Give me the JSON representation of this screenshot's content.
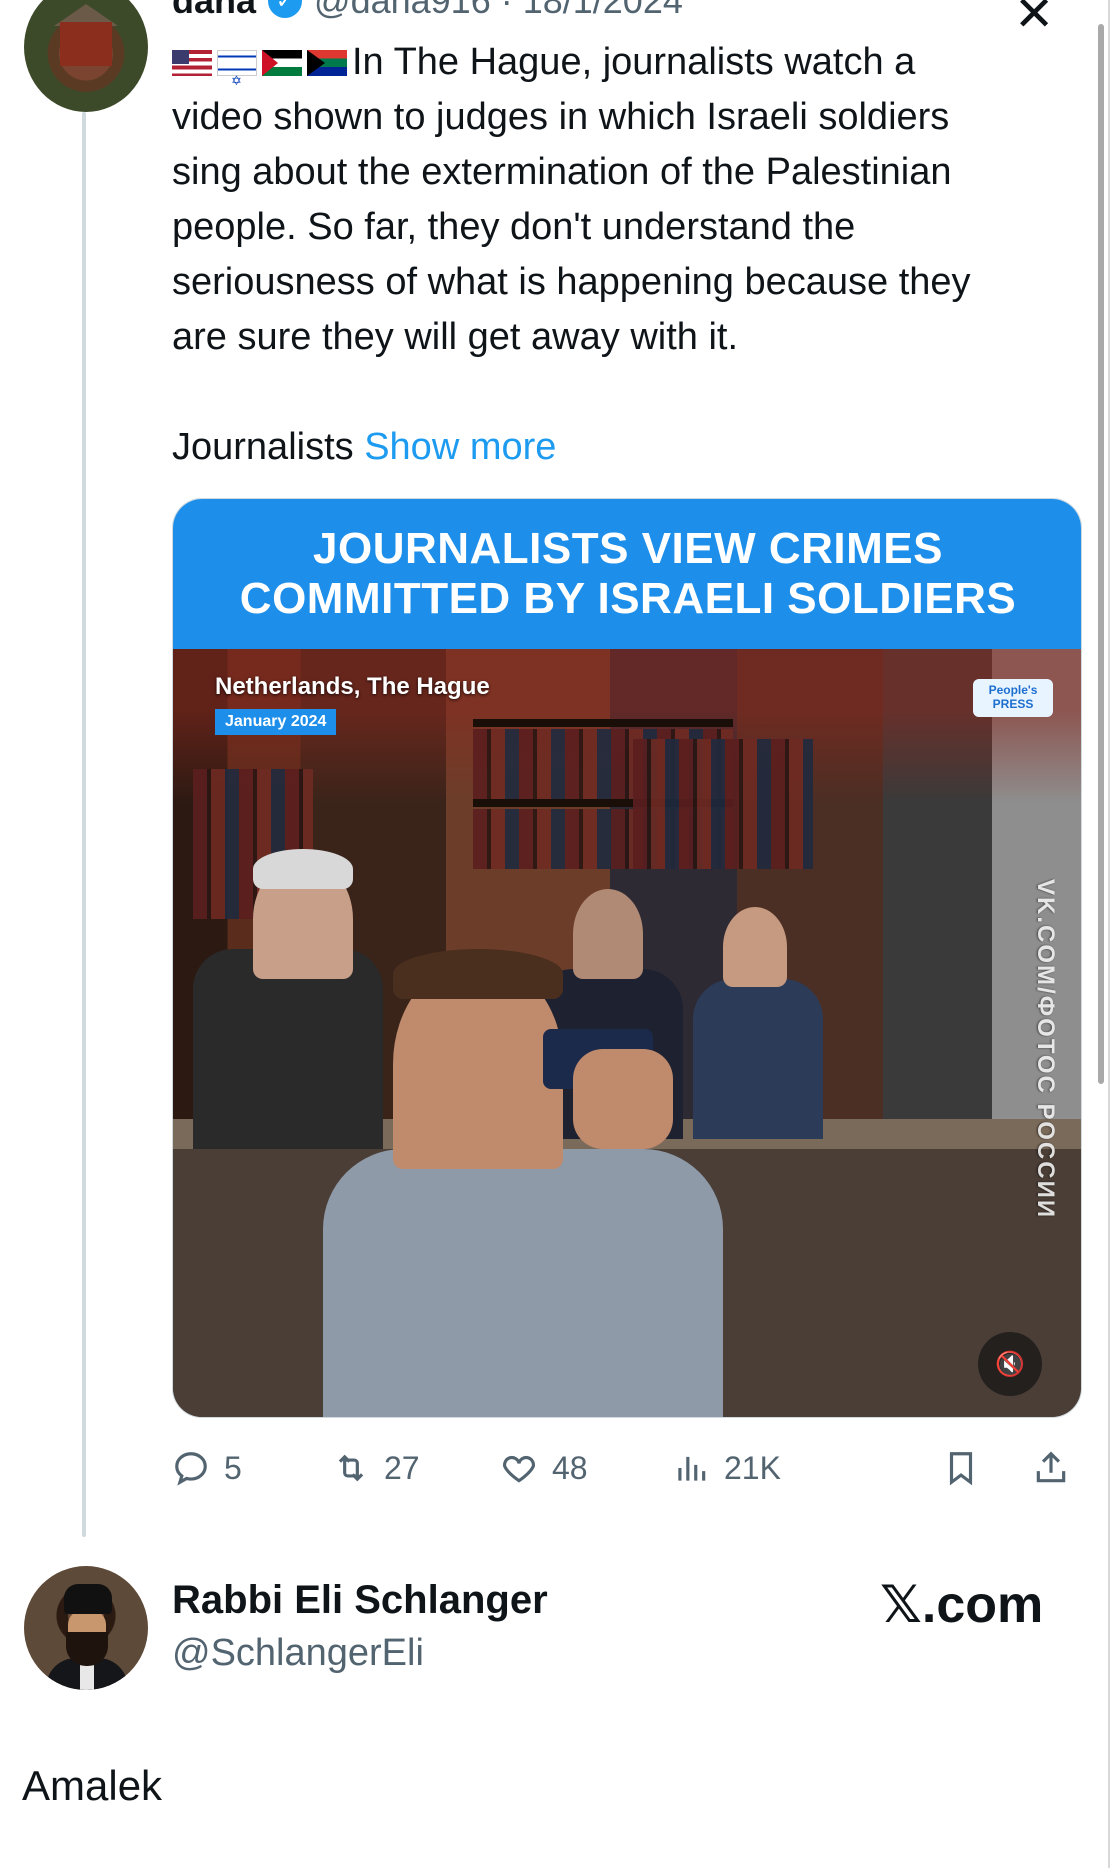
{
  "tweet": {
    "author_name": "dana",
    "handle_date": "@dana916 · 18/1/2024",
    "text_lines": [
      "In The Hague, journalists watch a",
      "video shown to judges in which Israeli soldiers",
      "sing about the extermination of the Palestinian",
      "people. So far, they don't understand the",
      "seriousness of what is happening because they",
      "are sure they will get away with it."
    ],
    "journalists_word": "Journalists",
    "show_more": "Show more",
    "media": {
      "banner_line1": "JOURNALISTS VIEW CRIMES",
      "banner_line2": "COMMITTED BY ISRAELI SOLDIERS",
      "location": "Netherlands, The Hague",
      "date_badge": "January 2024",
      "logo_line1": "People's",
      "logo_line2": "PRESS",
      "watermark": "VK.COM/ФОТОС РОССИИ"
    },
    "actions": {
      "replies": "5",
      "reposts": "27",
      "likes": "48",
      "views": "21K"
    }
  },
  "quote": {
    "author_name": "Rabbi Eli Schlanger",
    "handle": "@SchlangerEli",
    "site": "𝕏.com",
    "reply_text": "Amalek"
  },
  "colors": {
    "link": "#1d9bf0",
    "banner": "#1d8fea",
    "muted": "#536471"
  }
}
